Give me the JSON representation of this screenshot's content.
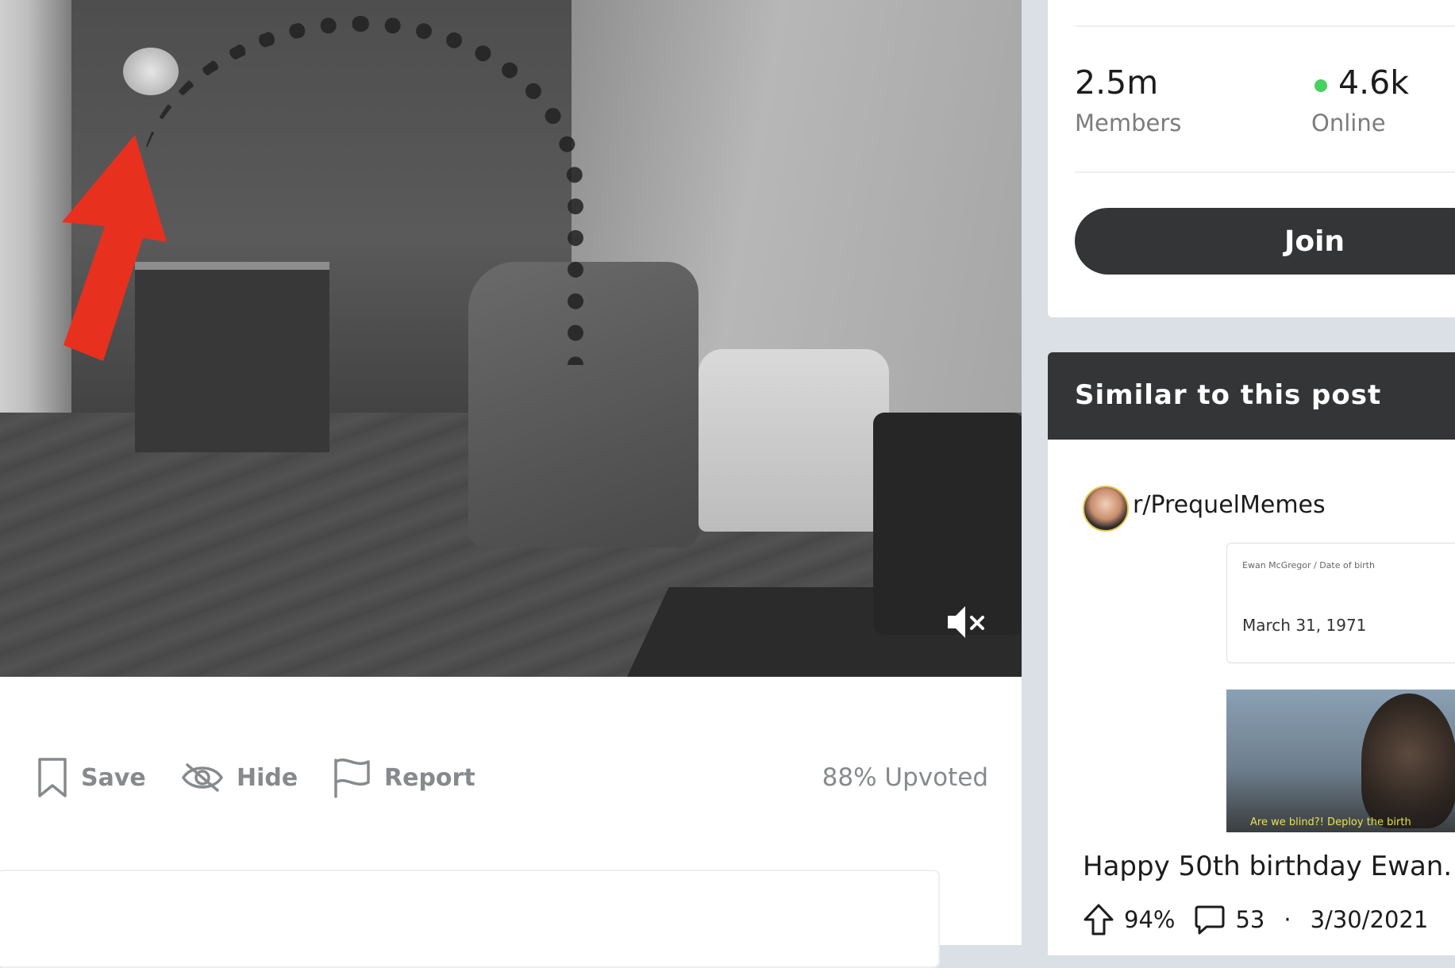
{
  "post_actions": {
    "save_label": "Save",
    "hide_label": "Hide",
    "report_label": "Report",
    "upvoted_text": "88% Upvoted"
  },
  "community": {
    "members_count": "2.5m",
    "members_label": "Members",
    "online_count": "4.6k",
    "online_label": "Online",
    "join_label": "Join",
    "online_color": "#46d160"
  },
  "similar": {
    "heading": "Similar to this post",
    "post": {
      "subreddit": "r/PrequelMemes",
      "thumbnail_header": "Ewan McGregor / Date of birth",
      "thumbnail_date": "March 31, 1971",
      "thumbnail_caption": "Are we blind?! Deploy the birth",
      "title": "Happy 50th birthday Ewan.",
      "upvote_ratio": "94%",
      "comments": "53",
      "separator": "·",
      "date": "3/30/2021"
    }
  },
  "icons": {
    "save": "bookmark-icon",
    "hide": "eye-slash-icon",
    "report": "flag-icon",
    "mute": "muted-speaker-icon",
    "upvote": "upvote-arrow-icon",
    "comment": "comment-bubble-icon"
  },
  "colors": {
    "dark_header": "#343536",
    "muted_text": "#878a8c",
    "arrow_red": "#e8301f"
  }
}
